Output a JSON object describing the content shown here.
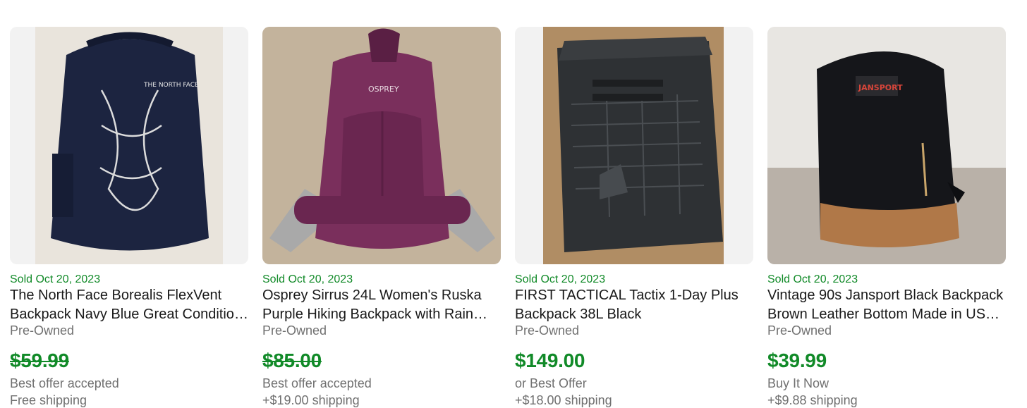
{
  "filter_chips": [
    "",
    "",
    "",
    ""
  ],
  "listings": [
    {
      "sold_date": "Sold Oct 20, 2023",
      "title": "The North Face Borealis FlexVent Backpack Navy Blue Great Condition Adults",
      "condition": "Pre-Owned",
      "price": "$59.99",
      "price_struck": true,
      "purchase_type": "Best offer accepted",
      "shipping": "Free shipping",
      "image_icon": "navy-backpack-image",
      "logo_text": "THE NORTH FACE",
      "bag_color": "#1c2440"
    },
    {
      "sold_date": "Sold Oct 20, 2023",
      "title": "Osprey Sirrus 24L Women's Ruska Purple Hiking Backpack with Rain Cover",
      "condition": "Pre-Owned",
      "price": "$85.00",
      "price_struck": true,
      "purchase_type": "Best offer accepted",
      "shipping": "+$19.00 shipping",
      "image_icon": "purple-backpack-image",
      "logo_text": "OSPREY",
      "bag_color": "#7a2f5c"
    },
    {
      "sold_date": "Sold Oct 20, 2023",
      "title": "FIRST TACTICAL Tactix 1-Day Plus Backpack 38L Black",
      "condition": "Pre-Owned",
      "price": "$149.00",
      "price_struck": false,
      "purchase_type": "or Best Offer",
      "shipping": "+$18.00 shipping",
      "image_icon": "tactical-backpack-image",
      "logo_text": "",
      "bag_color": "#2e3134"
    },
    {
      "sold_date": "Sold Oct 20, 2023",
      "title": "Vintage 90s Jansport Black Backpack Brown Leather Bottom Made in USA Classic",
      "condition": "Pre-Owned",
      "price": "$39.99",
      "price_struck": false,
      "purchase_type": "Buy It Now",
      "shipping": "+$9.88 shipping",
      "image_icon": "black-backpack-image",
      "logo_text": "JANSPORT",
      "bag_color": "#15161a"
    }
  ],
  "colors": {
    "accent": "#3665f3",
    "sold_green": "#118a28",
    "muted": "#707070"
  }
}
